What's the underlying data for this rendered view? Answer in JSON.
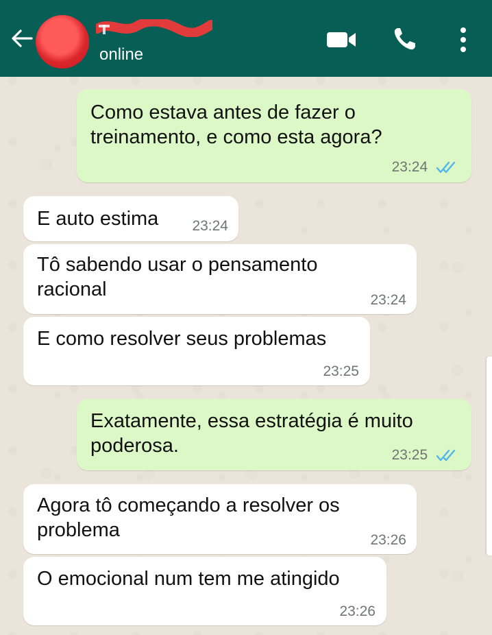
{
  "header": {
    "contact_name": "",
    "status": "online",
    "colors": {
      "bar": "#075e54",
      "avatar": "#d9262c",
      "redaction": "#e23b3b"
    },
    "icons": [
      "back-arrow-icon",
      "video-call-icon",
      "phone-call-icon",
      "more-options-icon"
    ]
  },
  "messages": [
    {
      "direction": "outgoing",
      "lines": [
        "Como estava antes de fazer o",
        "treinamento, e como esta agora?"
      ],
      "time": "23:24",
      "read_ticks": "double-check-icon"
    },
    {
      "direction": "incoming",
      "lines": [
        "E auto estima"
      ],
      "time": "23:24"
    },
    {
      "direction": "incoming",
      "lines": [
        "Tô sabendo usar o pensamento",
        "racional"
      ],
      "time": "23:24"
    },
    {
      "direction": "incoming",
      "lines": [
        "E como resolver seus problemas"
      ],
      "time": "23:25"
    },
    {
      "direction": "outgoing",
      "lines": [
        "Exatamente, essa estratégia é muito",
        "poderosa."
      ],
      "time": "23:25",
      "read_ticks": "double-check-icon"
    },
    {
      "direction": "incoming",
      "lines": [
        "Agora tô começando a resolver os",
        "problema"
      ],
      "time": "23:26"
    },
    {
      "direction": "incoming",
      "lines": [
        "O emocional num tem me atingido"
      ],
      "time": "23:26"
    }
  ],
  "colors": {
    "outgoing_bubble": "#dcf8c6",
    "incoming_bubble": "#ffffff",
    "read_tick": "#4fb6ec",
    "timestamp": "#6e7673"
  }
}
